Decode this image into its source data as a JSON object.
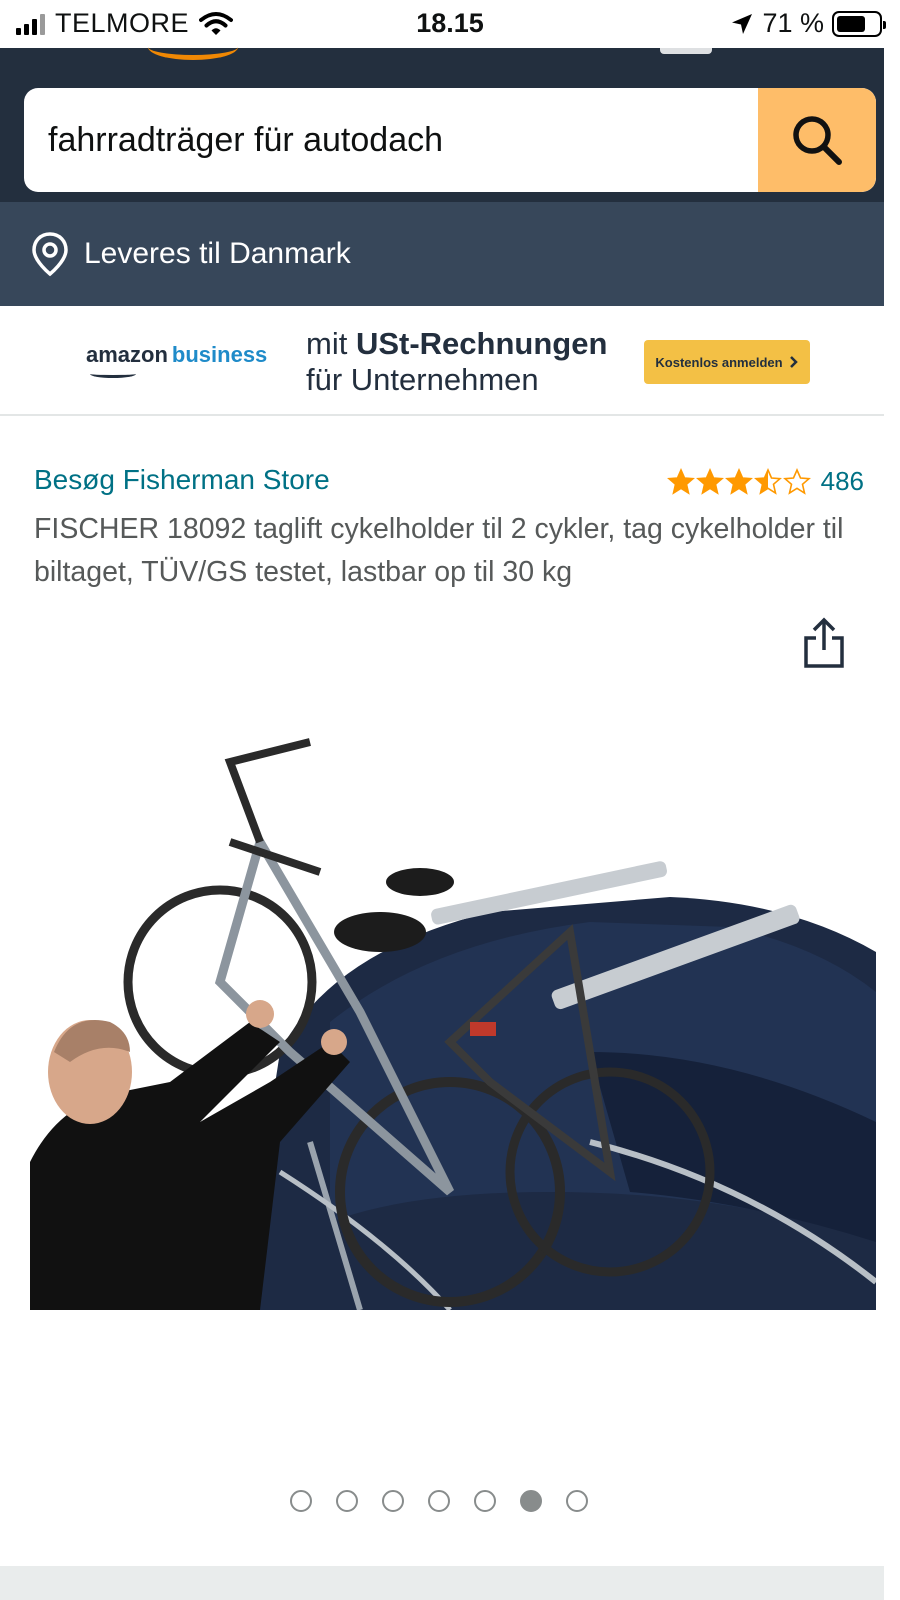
{
  "status_bar": {
    "carrier": "TELMORE",
    "time": "18.15",
    "battery_text": "71 %",
    "battery_level": 0.71
  },
  "header": {
    "search": {
      "value": "fahrradträger für autodach",
      "button_icon": "search-icon"
    }
  },
  "delivery": {
    "icon": "location-pin-icon",
    "text": "Leveres til Danmark"
  },
  "ad_banner": {
    "logo_amazon": "amazon",
    "logo_business": "business",
    "headline_prefix": "mit ",
    "headline_bold": "USt-Rechnungen",
    "headline_line2": "für Unternehmen",
    "cta_label": "Kostenlos anmelden",
    "cta_icon": "chevron-right-icon"
  },
  "product": {
    "store_link": "Besøg Fisherman Store",
    "rating_value": 3.5,
    "rating_max": 5,
    "rating_count": "486",
    "title": "FISCHER 18092 taglift cykelholder til 2 cykler, tag cykelholder til biltaget, TÜV/GS testet, lastbar op til 30 kg",
    "share_icon": "share-icon"
  },
  "carousel": {
    "total": 7,
    "active_index": 5
  },
  "colors": {
    "header_bg": "#232f3e",
    "delivery_bg": "#37475a",
    "search_button": "#febd69",
    "link": "#007185",
    "star": "#ff9900"
  }
}
